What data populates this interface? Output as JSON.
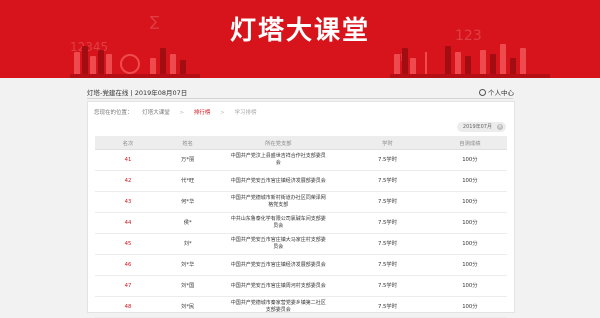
{
  "banner": {
    "title": "灯塔大课堂"
  },
  "topbar": {
    "site": "灯塔-党建在线",
    "date": "2019年08月07日",
    "user_center": "个人中心"
  },
  "breadcrumb": {
    "prefix": "您现在的位置：",
    "items": [
      "灯塔大课堂",
      "排行榜",
      "学习排榜"
    ]
  },
  "filter": {
    "date_chip": "2019年07月"
  },
  "table": {
    "headers": [
      "名次",
      "姓名",
      "所在党支部",
      "学时",
      "自测成绩"
    ],
    "rows": [
      {
        "rank": "41",
        "name": "万*丽",
        "org": "中国共产党汶上县盛世吉祥合作社支部委员会",
        "hours": "7.5学时",
        "score": "100分"
      },
      {
        "rank": "42",
        "name": "代*旺",
        "org": "中国共产党安丘市官庄镇经济发展部委员会",
        "hours": "7.5学时",
        "score": "100分"
      },
      {
        "rank": "43",
        "name": "何*华",
        "org": "中国共产党德城市新村街道办社区同荣泽网格党支部",
        "hours": "7.5学时",
        "score": "100分"
      },
      {
        "rank": "44",
        "name": "侯*",
        "org": "中共山东鲁泰化学有限公司氯碱车间支部委员会",
        "hours": "7.5学时",
        "score": "100分"
      },
      {
        "rank": "45",
        "name": "刘*",
        "org": "中国共产党安丘市官庄镇大马家庄村支部委员会",
        "hours": "7.5学时",
        "score": "100分"
      },
      {
        "rank": "46",
        "name": "刘*华",
        "org": "中国共产党安丘市官庄镇经济发展部委员会",
        "hours": "7.5学时",
        "score": "100分"
      },
      {
        "rank": "47",
        "name": "刘*国",
        "org": "中国共产党安丘市官庄镇周河村支部委员会",
        "hours": "7.5学时",
        "score": "100分"
      },
      {
        "rank": "48",
        "name": "刘*民",
        "org": "中国共产党德城市秦家营党委乡镇第二社区支部委员会",
        "hours": "7.5学时",
        "score": "100分"
      }
    ]
  }
}
